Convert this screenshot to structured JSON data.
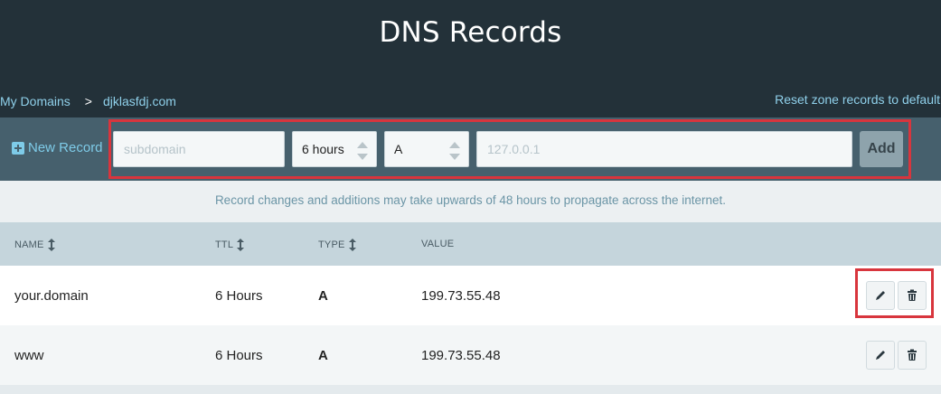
{
  "header": {
    "title": "DNS Records",
    "breadcrumb": {
      "root": "My Domains",
      "separator": ">",
      "current": "djklasfdj.com"
    },
    "reset_link": "Reset zone records to default"
  },
  "new_record": {
    "label": "New Record",
    "subdomain_placeholder": "subdomain",
    "ttl_value": "6 hours",
    "type_value": "A",
    "value_placeholder": "127.0.0.1",
    "add_label": "Add"
  },
  "notice": "Record changes and additions may take upwards of 48 hours to propagate across the internet.",
  "table": {
    "columns": {
      "name": "NAME",
      "ttl": "TTL",
      "type": "TYPE",
      "value": "VALUE"
    },
    "rows": [
      {
        "name": "your.domain",
        "ttl": "6 Hours",
        "type": "A",
        "value": "199.73.55.48"
      },
      {
        "name": "www",
        "ttl": "6 Hours",
        "type": "A",
        "value": "199.73.55.48"
      }
    ]
  },
  "colors": {
    "header_bg": "#233139",
    "toolbar_bg": "#46606d",
    "link": "#8fd0ea",
    "highlight": "#d8353d",
    "table_header_bg": "#c5d5dc"
  },
  "icons": [
    "plus-icon",
    "sort-icon",
    "pencil-icon",
    "trash-icon"
  ]
}
